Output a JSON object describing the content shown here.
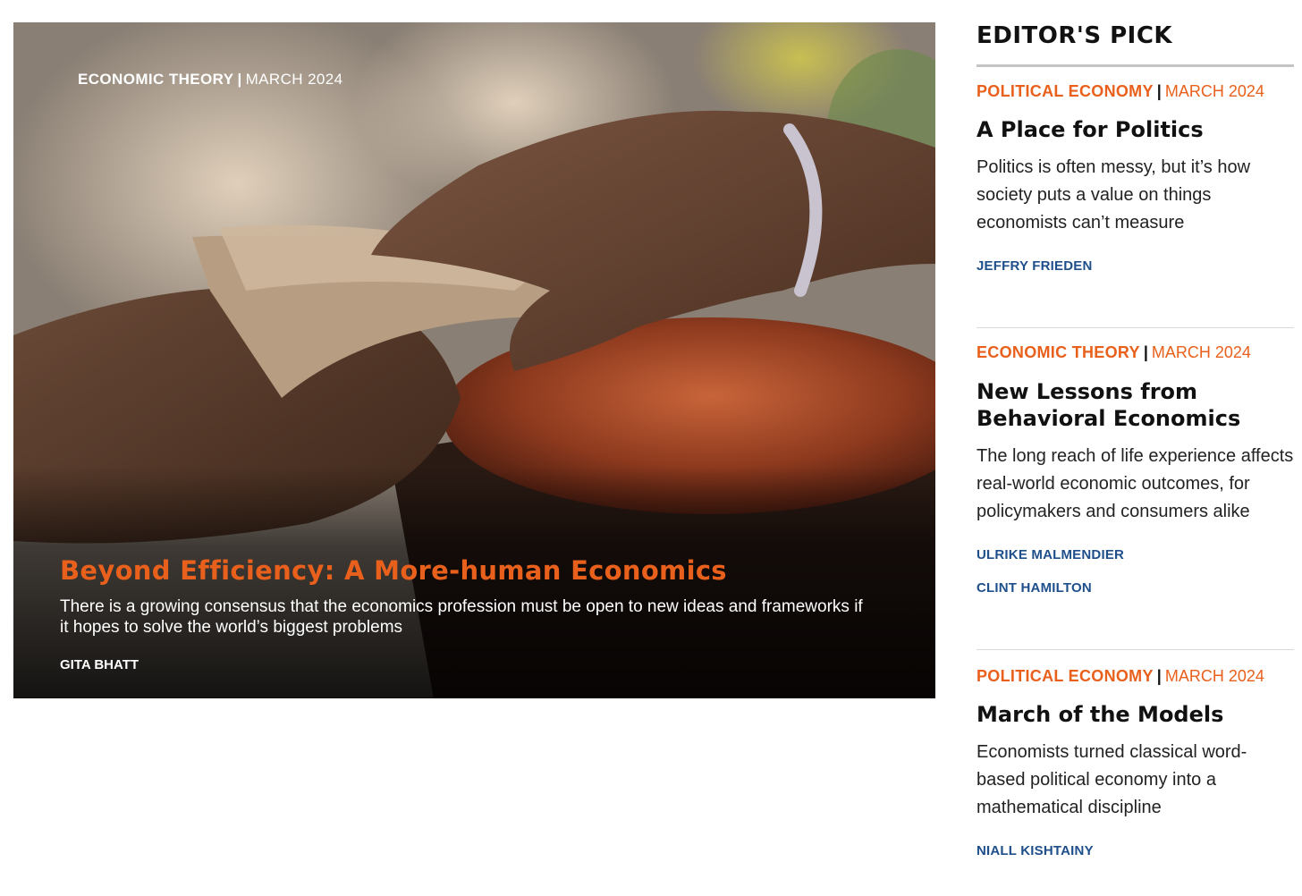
{
  "hero": {
    "category": "ECONOMIC THEORY",
    "separator": "|",
    "date": "MARCH 2024",
    "title": "Beyond Efficiency: A More-human Economics",
    "dek": "There is a growing consensus that the economics profession must be open to new ideas and frameworks if it hopes to solve the world’s biggest problems",
    "author": "GITA BHATT"
  },
  "sidebar": {
    "heading": "EDITOR'S PICK",
    "items": [
      {
        "category": "POLITICAL ECONOMY",
        "separator": "|",
        "date": "MARCH 2024",
        "title": "A Place for Politics",
        "dek": "Politics is often messy, but it’s how society puts a value on things economists can’t measure",
        "authors": [
          "JEFFRY FRIEDEN"
        ]
      },
      {
        "category": "ECONOMIC THEORY",
        "separator": "|",
        "date": "MARCH 2024",
        "title": "New Lessons from Behavioral Economics",
        "dek": "The long reach of life experience affects real-world economic outcomes, for policymakers and consumers alike",
        "authors": [
          "ULRIKE MALMENDIER",
          "CLINT HAMILTON"
        ]
      },
      {
        "category": "POLITICAL ECONOMY",
        "separator": "|",
        "date": "MARCH 2024",
        "title": "March of the Models",
        "dek": "Economists turned classical word-based political economy into a mathematical discipline",
        "authors": [
          "NIALL KISHTAINY"
        ]
      }
    ]
  },
  "colors": {
    "accent_orange": "#e8601c",
    "author_blue": "#1f4f8b",
    "rule_gray": "#c4c4c4"
  }
}
